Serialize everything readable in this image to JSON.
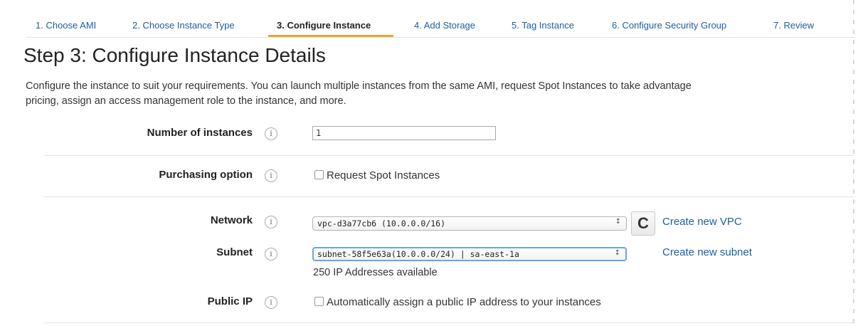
{
  "wizard": {
    "tabs": [
      {
        "label": "1. Choose AMI"
      },
      {
        "label": "2. Choose Instance Type"
      },
      {
        "label": "3. Configure Instance"
      },
      {
        "label": "4. Add Storage"
      },
      {
        "label": "5. Tag Instance"
      },
      {
        "label": "6. Configure Security Group"
      },
      {
        "label": "7. Review"
      }
    ],
    "active_tab": 2,
    "accent_color": "#f0a23c"
  },
  "page": {
    "title": "Step 3: Configure Instance Details",
    "description_line1": "Configure the instance to suit your requirements. You can launch multiple instances from the same AMI, request Spot Instances to take advantage",
    "description_line2": "pricing, assign an access management role to the instance, and more."
  },
  "form": {
    "info_icon_glyph": "i",
    "number_of_instances": {
      "label": "Number of instances",
      "value": "1"
    },
    "purchasing_option": {
      "label": "Purchasing option",
      "checkbox_label": "Request Spot Instances",
      "checked": false
    },
    "network": {
      "label": "Network",
      "selected": "vpc-d3a77cb6 (10.0.0.0/16)",
      "refresh_glyph": "C",
      "create_link": "Create new VPC"
    },
    "subnet": {
      "label": "Subnet",
      "selected": "subnet-58f5e63a(10.0.0.0/24) | sa-east-1a",
      "create_link": "Create new subnet",
      "available": "250 IP Addresses available"
    },
    "public_ip": {
      "label": "Public IP",
      "checkbox_label": "Automatically assign a public IP address to your instances",
      "checked": false
    },
    "select_arrow_glyph": "↕"
  }
}
